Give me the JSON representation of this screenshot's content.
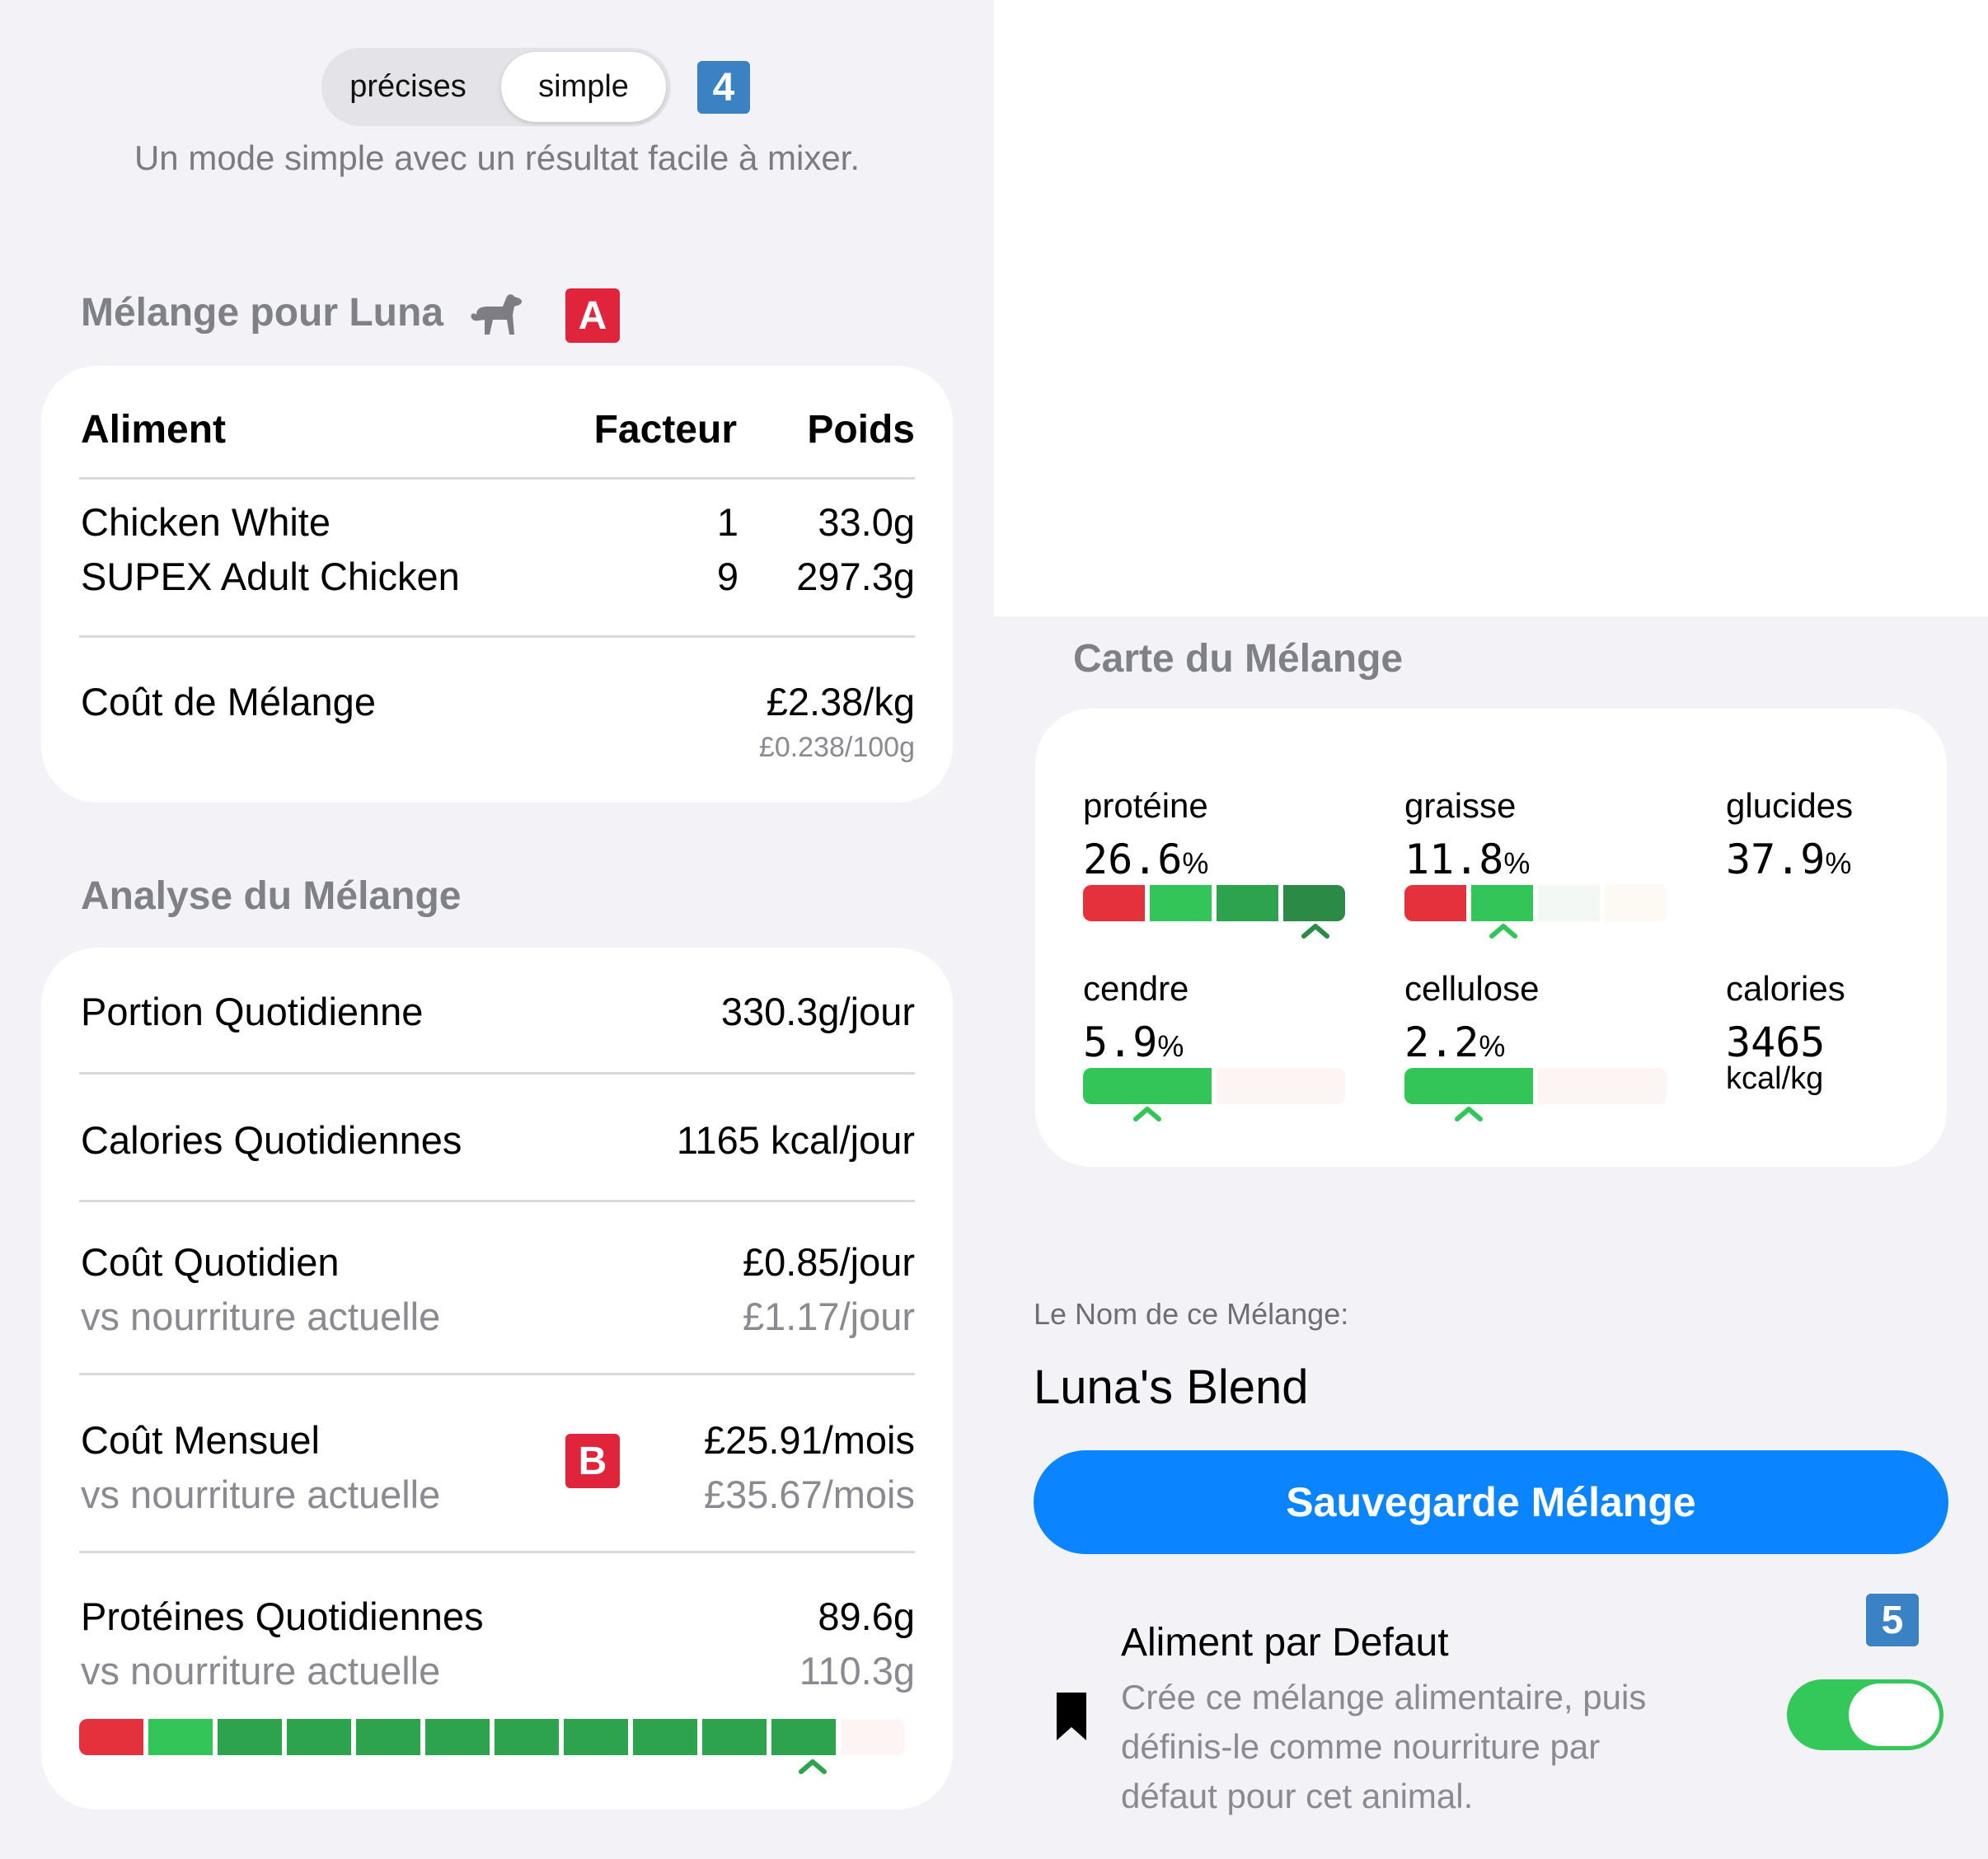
{
  "mode_switch": {
    "option_precise": "précises",
    "option_simple": "simple",
    "selected": "simple",
    "badge": "4",
    "description": "Un mode simple avec un résultat facile à mixer."
  },
  "blend": {
    "title": "Mélange pour Luna",
    "badge": "A",
    "headers": {
      "food": "Aliment",
      "factor": "Facteur",
      "weight": "Poids"
    },
    "rows": [
      {
        "food": "Chicken White",
        "factor": "1",
        "weight": "33.0g"
      },
      {
        "food": "SUPEX Adult Chicken",
        "factor": "9",
        "weight": "297.3g"
      }
    ],
    "cost_label": "Coût de Mélange",
    "cost_value": "£2.38/kg",
    "cost_sub": "£0.238/100g"
  },
  "analysis": {
    "title": "Analyse du Mélange",
    "portion_label": "Portion Quotidienne",
    "portion_value": "330.3g/jour",
    "calories_label": "Calories Quotidiennes",
    "calories_value": "1165 kcal/jour",
    "daily_cost_label": "Coût Quotidien",
    "daily_cost_sub": "vs nourriture actuelle",
    "daily_cost_value": "£0.85/jour",
    "daily_cost_current": "£1.17/jour",
    "monthly_cost_label": "Coût Mensuel",
    "monthly_cost_sub": "vs nourriture actuelle",
    "monthly_cost_value": "£25.91/mois",
    "monthly_cost_current": "£35.67/mois",
    "monthly_badge": "B",
    "protein_label": "Protéines Quotidiennes",
    "protein_sub": "vs nourriture actuelle",
    "protein_value": "89.6g",
    "protein_current": "110.3g"
  },
  "map": {
    "title": "Carte du Mélange",
    "protein_label": "protéine",
    "protein_value": "26.6",
    "protein_unit": "%",
    "fat_label": "graisse",
    "fat_value": "11.8",
    "fat_unit": "%",
    "carbs_label": "glucides",
    "carbs_value": "37.9",
    "carbs_unit": "%",
    "ash_label": "cendre",
    "ash_value": "5.9",
    "ash_unit": "%",
    "fiber_label": "cellulose",
    "fiber_value": "2.2",
    "fiber_unit": "%",
    "calories_label": "calories",
    "calories_value": "3465",
    "calories_unit": "kcal/kg"
  },
  "name_section": {
    "label": "Le Nom de ce Mélange:",
    "value": "Luna's Blend",
    "save_button": "Sauvegarde Mélange"
  },
  "default_food": {
    "badge": "5",
    "title": "Aliment par Defaut",
    "description_line1": "Crée ce mélange alimentaire, puis",
    "description_line2": "définis-le comme nourriture par",
    "description_line3": "défaut pour cet animal.",
    "enabled": true
  },
  "colors": {
    "accent": "#0a84ff",
    "toggle_on": "#34c759",
    "bar_red": "#e5313b",
    "bar_green": "#34c559",
    "badge_red": "#e0243c",
    "badge_blue": "#3b82c4"
  }
}
